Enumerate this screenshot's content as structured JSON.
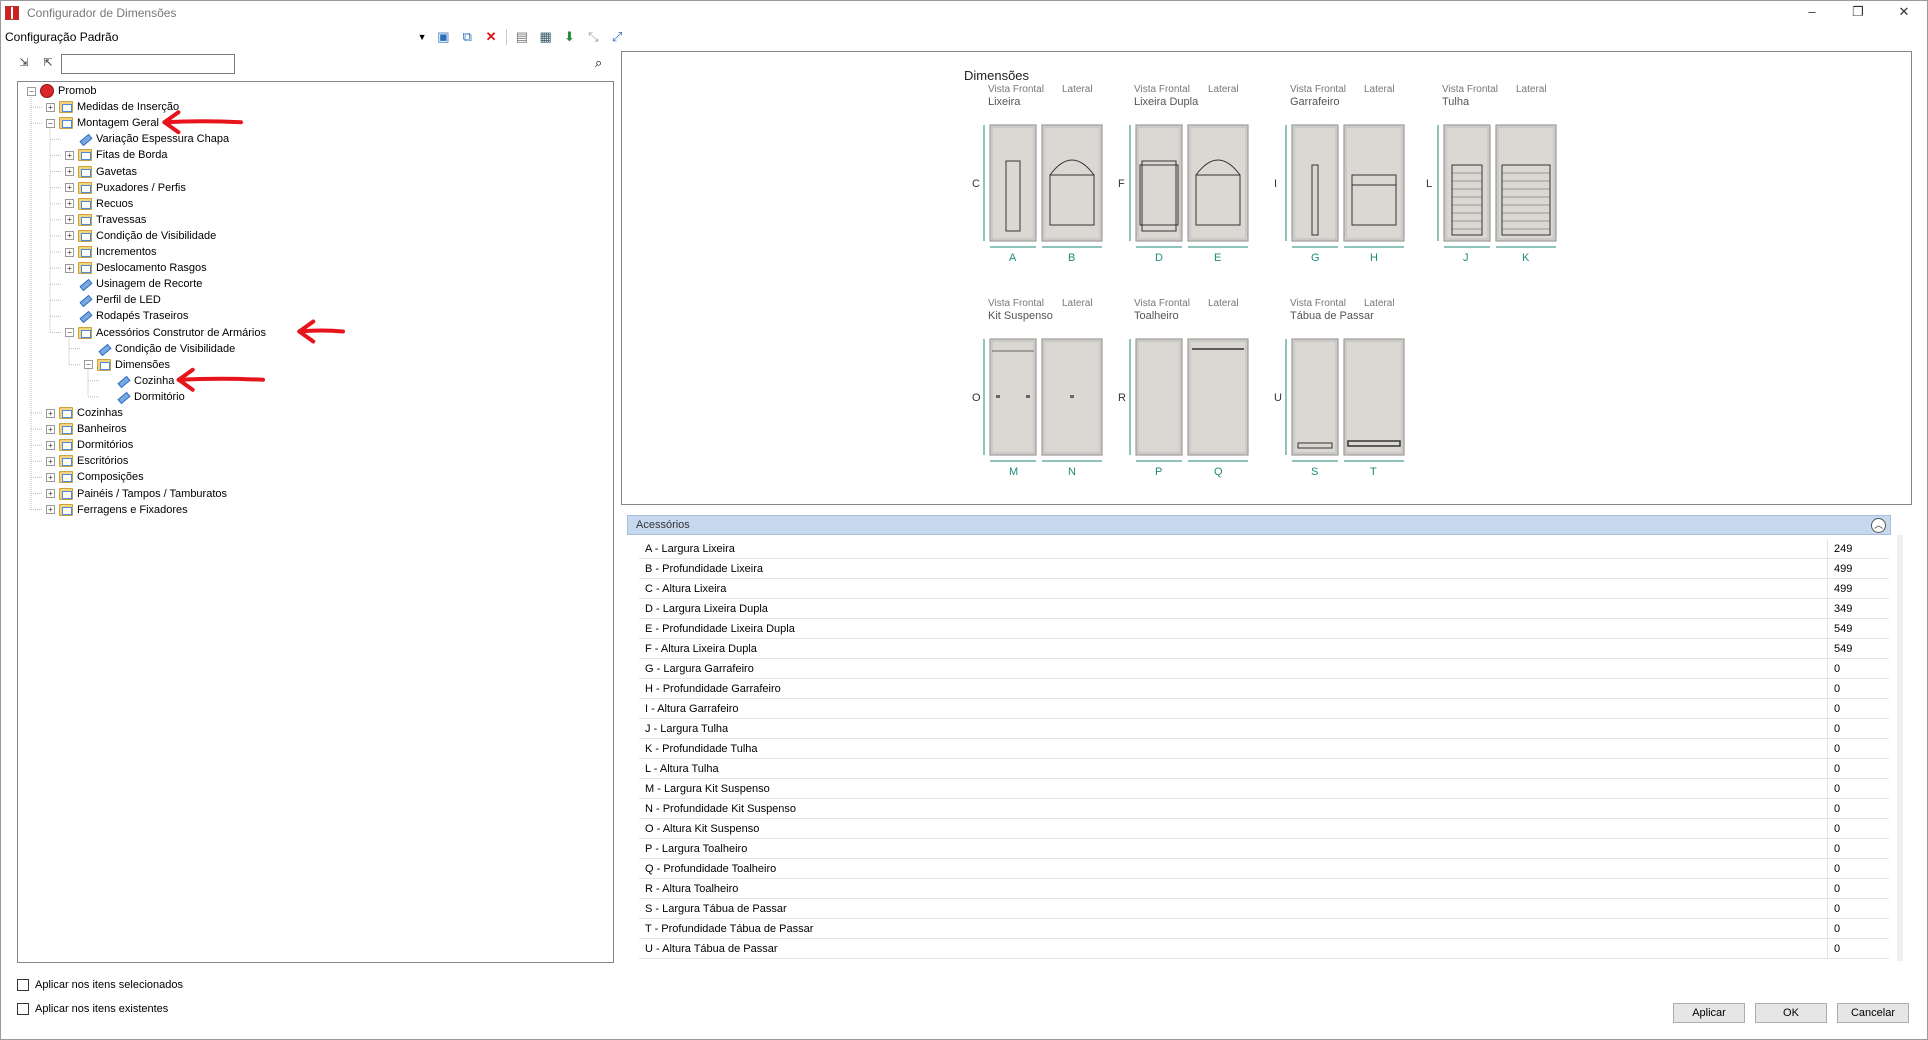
{
  "window": {
    "title": "Configurador de Dimensões",
    "controls": [
      "–",
      "❐",
      "✕"
    ]
  },
  "toolbar": {
    "config_value": "Configuração Padrão",
    "icons": [
      "window-check-icon",
      "copy-icon",
      "delete-icon",
      "save-icon",
      "save-all-icon",
      "apply-icon",
      "collapse-icon",
      "expand-icon"
    ]
  },
  "tree": {
    "items": [
      {
        "label": "Promob",
        "level": 0,
        "expander": "−",
        "icon": "root"
      },
      {
        "label": "Medidas de Inserção",
        "level": 1,
        "expander": "+",
        "icon": "folder"
      },
      {
        "label": "Montagem Geral",
        "level": 1,
        "expander": "−",
        "icon": "folder"
      },
      {
        "label": "Variação Espessura Chapa",
        "level": 2,
        "expander": "",
        "icon": "leaf"
      },
      {
        "label": "Fitas de Borda",
        "level": 2,
        "expander": "+",
        "icon": "folder"
      },
      {
        "label": "Gavetas",
        "level": 2,
        "expander": "+",
        "icon": "folder"
      },
      {
        "label": "Puxadores / Perfis",
        "level": 2,
        "expander": "+",
        "icon": "folder"
      },
      {
        "label": "Recuos",
        "level": 2,
        "expander": "+",
        "icon": "folder"
      },
      {
        "label": "Travessas",
        "level": 2,
        "expander": "+",
        "icon": "folder"
      },
      {
        "label": "Condição de Visibilidade",
        "level": 2,
        "expander": "+",
        "icon": "folder"
      },
      {
        "label": "Incrementos",
        "level": 2,
        "expander": "+",
        "icon": "folder"
      },
      {
        "label": "Deslocamento Rasgos",
        "level": 2,
        "expander": "+",
        "icon": "folder"
      },
      {
        "label": "Usinagem de Recorte",
        "level": 2,
        "expander": "",
        "icon": "leaf"
      },
      {
        "label": "Perfil de LED",
        "level": 2,
        "expander": "",
        "icon": "leaf"
      },
      {
        "label": "Rodapés Traseiros",
        "level": 2,
        "expander": "",
        "icon": "leaf"
      },
      {
        "label": "Acessórios Construtor de Armários",
        "level": 2,
        "expander": "−",
        "icon": "folder"
      },
      {
        "label": "Condição de Visibilidade",
        "level": 3,
        "expander": "",
        "icon": "leaf"
      },
      {
        "label": "Dimensões",
        "level": 3,
        "expander": "−",
        "icon": "folder"
      },
      {
        "label": "Cozinha",
        "level": 4,
        "expander": "",
        "icon": "leaf"
      },
      {
        "label": "Dormitório",
        "level": 4,
        "expander": "",
        "icon": "leaf"
      },
      {
        "label": "Cozinhas",
        "level": 1,
        "expander": "+",
        "icon": "folder"
      },
      {
        "label": "Banheiros",
        "level": 1,
        "expander": "+",
        "icon": "folder"
      },
      {
        "label": "Dormitórios",
        "level": 1,
        "expander": "+",
        "icon": "folder"
      },
      {
        "label": "Escritórios",
        "level": 1,
        "expander": "+",
        "icon": "folder"
      },
      {
        "label": "Composições",
        "level": 1,
        "expander": "+",
        "icon": "folder"
      },
      {
        "label": "Painéis / Tampos / Tamburatos",
        "level": 1,
        "expander": "+",
        "icon": "folder"
      },
      {
        "label": "Ferragens e Fixadores",
        "level": 1,
        "expander": "+",
        "icon": "folder"
      }
    ],
    "highlighted": [
      2,
      15,
      18
    ],
    "annotation_color": "#e8141b"
  },
  "options": {
    "apply_selected": "Aplicar nos itens selecionados",
    "apply_existing": "Aplicar nos itens existentes"
  },
  "preview": {
    "title": "Dimensões",
    "front_label": "Vista Frontal",
    "side_label": "Lateral",
    "groups": [
      {
        "name": "Lixeira",
        "height_letter": "C",
        "letters": [
          "A",
          "B"
        ]
      },
      {
        "name": "Lixeira Dupla",
        "height_letter": "F",
        "letters": [
          "D",
          "E"
        ]
      },
      {
        "name": "Garrafeiro",
        "height_letter": "I",
        "letters": [
          "G",
          "H"
        ]
      },
      {
        "name": "Tulha",
        "height_letter": "L",
        "letters": [
          "J",
          "K"
        ]
      },
      {
        "name": "Kit Suspenso",
        "height_letter": "O",
        "letters": [
          "M",
          "N"
        ]
      },
      {
        "name": "Toalheiro",
        "height_letter": "R",
        "letters": [
          "P",
          "Q"
        ]
      },
      {
        "name": "Tábua de Passar",
        "height_letter": "U",
        "letters": [
          "S",
          "T"
        ]
      }
    ],
    "dim_color": "#1f8a7a",
    "cabinet_color": "#dbd8d3"
  },
  "accessories": {
    "header": "Acessórios",
    "rows": [
      {
        "label": "A -  Largura Lixeira",
        "value": "249"
      },
      {
        "label": "B -  Profundidade Lixeira",
        "value": "499"
      },
      {
        "label": "C -  Altura Lixeira",
        "value": "499"
      },
      {
        "label": "D -  Largura Lixeira Dupla",
        "value": "349"
      },
      {
        "label": "E -  Profundidade Lixeira Dupla",
        "value": "549"
      },
      {
        "label": "F -  Altura Lixeira Dupla",
        "value": "549"
      },
      {
        "label": "G -  Largura Garrafeiro",
        "value": "0"
      },
      {
        "label": "H -  Profundidade Garrafeiro",
        "value": "0"
      },
      {
        "label": "I -  Altura Garrafeiro",
        "value": "0"
      },
      {
        "label": "J -  Largura Tulha",
        "value": "0"
      },
      {
        "label": "K -  Profundidade Tulha",
        "value": "0"
      },
      {
        "label": "L -  Altura Tulha",
        "value": "0"
      },
      {
        "label": "M -  Largura Kit Suspenso",
        "value": "0"
      },
      {
        "label": "N -  Profundidade Kit Suspenso",
        "value": "0"
      },
      {
        "label": "O -  Altura Kit Suspenso",
        "value": "0"
      },
      {
        "label": "P -  Largura Toalheiro",
        "value": "0"
      },
      {
        "label": "Q -  Profundidade Toalheiro",
        "value": "0"
      },
      {
        "label": "R -  Altura Toalheiro",
        "value": "0"
      },
      {
        "label": "S -  Largura Tábua de Passar",
        "value": "0"
      },
      {
        "label": "T -  Profundidade Tábua de Passar",
        "value": "0"
      },
      {
        "label": "U -  Altura Tábua de Passar",
        "value": "0"
      }
    ]
  },
  "buttons": {
    "apply": "Aplicar",
    "ok": "OK",
    "cancel": "Cancelar"
  }
}
